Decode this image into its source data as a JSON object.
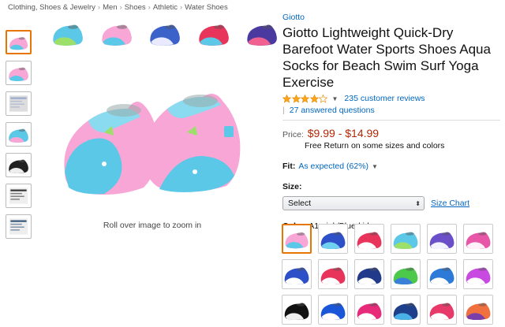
{
  "breadcrumb": [
    "Clothing, Shoes & Jewelry",
    "Men",
    "Shoes",
    "Athletic",
    "Water Shoes"
  ],
  "product": {
    "brand": "Giotto",
    "title": "Giotto Lightweight Quick-Dry Barefoot Water Sports Shoes Aqua Socks for Beach Swim Surf Yoga Exercise",
    "rating_stars": 4,
    "rating_max": 5,
    "reviews": "235 customer reviews",
    "answered": "27 answered questions",
    "price_label": "Price:",
    "price": "$9.99 - $14.99",
    "free_return": "Free Return on some sizes and colors",
    "fit_label": "Fit:",
    "fit_value": "As expected (62%)",
    "size_label": "Size:",
    "size_selected": "Select",
    "size_chart": "Size Chart",
    "color_label": "Color:",
    "color_value": "A1-pink/Blue-kids"
  },
  "zoom_hint": "Roll over image to zoom in",
  "thumbnails": [
    {
      "icon": "shoe-pink-blue",
      "c1": "#f7a6d6",
      "c2": "#5cc8e8"
    },
    {
      "icon": "shoe-pink-blue-side",
      "c1": "#f7a6d6",
      "c2": "#5cc8e8"
    },
    {
      "icon": "size-chart",
      "c1": "#9ac",
      "c2": "#ddd"
    },
    {
      "icon": "shoe-sole",
      "c1": "#5cc8e8",
      "c2": "#f7a6d6"
    },
    {
      "icon": "shoe-black-sole",
      "c1": "#222",
      "c2": "#eee"
    },
    {
      "icon": "feature-panel",
      "c1": "#333",
      "c2": "#eee"
    },
    {
      "icon": "feature-panel-2",
      "c1": "#357",
      "c2": "#eee"
    }
  ],
  "top_strip": [
    {
      "c1": "#5cc8e8",
      "c2": "#9ce06a"
    },
    {
      "c1": "#f7a6d6",
      "c2": "#5cc8e8"
    },
    {
      "c1": "#3a62c8",
      "c2": "#e9e9ff"
    },
    {
      "c1": "#e8345a",
      "c2": "#5cc8e8"
    },
    {
      "c1": "#4a3aa0",
      "c2": "#f06090"
    }
  ],
  "swatches": [
    {
      "c1": "#f7a6d6",
      "c2": "#5cc8e8",
      "selected": true
    },
    {
      "c1": "#2d4fc8",
      "c2": "#6fd0f0"
    },
    {
      "c1": "#e8345a",
      "c2": "#ffffff"
    },
    {
      "c1": "#5cc8e8",
      "c2": "#9ce06a"
    },
    {
      "c1": "#6a4fc8",
      "c2": "#f3f3ff"
    },
    {
      "c1": "#e856a8",
      "c2": "#fff0fa"
    },
    {
      "c1": "#2d4fc8",
      "c2": "#ffffff"
    },
    {
      "c1": "#e8345a",
      "c2": "#ffffff"
    },
    {
      "c1": "#223a8a",
      "c2": "#ffffff"
    },
    {
      "c1": "#4cc84a",
      "c2": "#3a7fd8"
    },
    {
      "c1": "#2d7ad8",
      "c2": "#ffffff"
    },
    {
      "c1": "#c84ae0",
      "c2": "#ffffff"
    },
    {
      "c1": "#111111",
      "c2": "#eeeeee"
    },
    {
      "c1": "#1a56d8",
      "c2": "#ffffff"
    },
    {
      "c1": "#e82a7a",
      "c2": "#ffffff"
    },
    {
      "c1": "#1e3f8a",
      "c2": "#4ab0e8"
    },
    {
      "c1": "#e83a6a",
      "c2": "#ffffff"
    },
    {
      "c1": "#f07040",
      "c2": "#7a3fa8"
    }
  ]
}
